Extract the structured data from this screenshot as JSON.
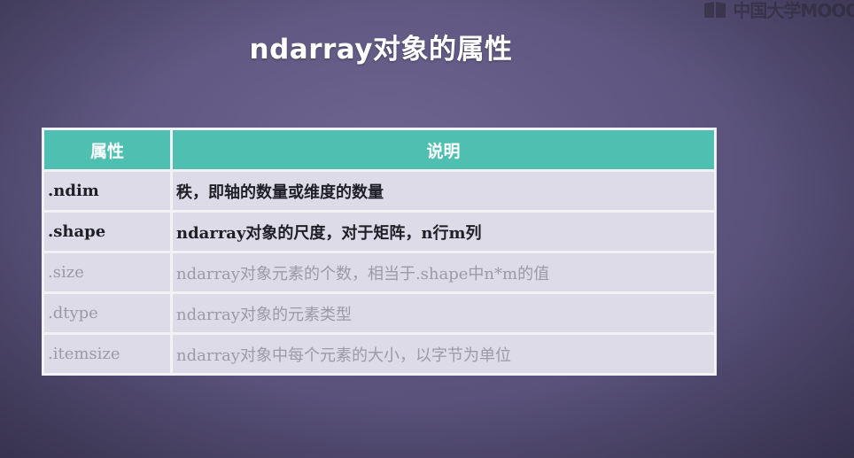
{
  "watermark": {
    "text": "中国大学MOOC"
  },
  "slide": {
    "title": "ndarray对象的属性"
  },
  "table": {
    "headers": [
      "属性",
      "说明"
    ],
    "rows": [
      {
        "attr": ".ndim",
        "desc": "秩，即轴的数量或维度的数量",
        "emphasis": "bold"
      },
      {
        "attr": ".shape",
        "desc": "ndarray对象的尺度，对于矩阵，n行m列",
        "emphasis": "bold"
      },
      {
        "attr": ".size",
        "desc": "ndarray对象元素的个数，相当于.shape中n*m的值",
        "emphasis": "dim"
      },
      {
        "attr": ".dtype",
        "desc": "ndarray对象的元素类型",
        "emphasis": "dim"
      },
      {
        "attr": ".itemsize",
        "desc": "ndarray对象中每个元素的大小，以字节为单位",
        "emphasis": "dim"
      }
    ]
  },
  "colors": {
    "background": "#5e5680",
    "header": "#4fbfb1",
    "cell": "#dcdbe7",
    "text_active": "#1f1f26",
    "text_dim": "#9b9aa7"
  }
}
